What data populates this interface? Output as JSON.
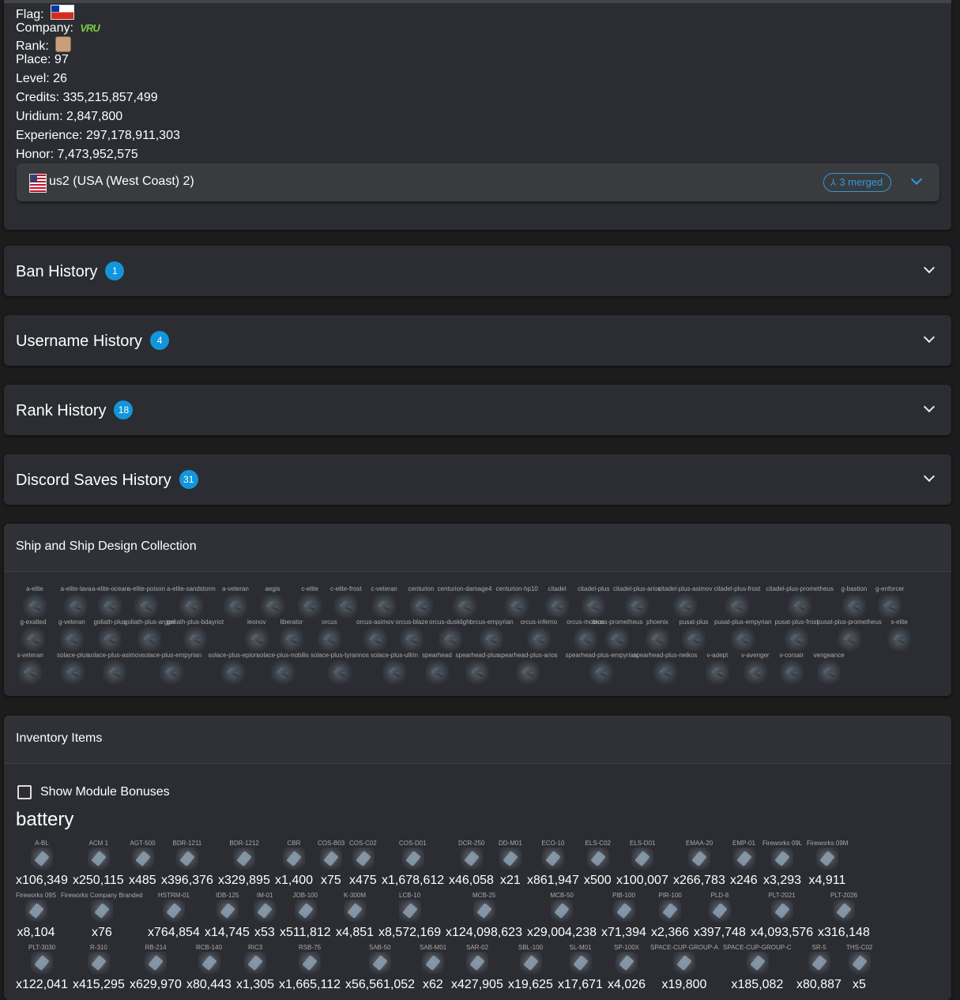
{
  "profile": {
    "flag_label": "Flag:",
    "company_label": "Company:",
    "company_logo_text": "VRU",
    "rank_label": "Rank:",
    "place": "Place: 97",
    "level": "Level: 26",
    "credits": "Credits: 335,215,857,499",
    "uridium": "Uridium: 2,847,800",
    "experience": "Experience: 297,178,911,303",
    "honor": "Honor: 7,473,952,575"
  },
  "server": {
    "name": "us2 (USA (West Coast) 2)",
    "merged_label": "3 merged"
  },
  "history_sections": [
    {
      "title": "Ban History",
      "count": "1"
    },
    {
      "title": "Username History",
      "count": "4"
    },
    {
      "title": "Rank History",
      "count": "18"
    },
    {
      "title": "Discord Saves History",
      "count": "31"
    }
  ],
  "ships": {
    "title": "Ship and Ship Design Collection",
    "row1": [
      "a-elite",
      "a-elite-lava",
      "a-elite-ocean",
      "a-elite-poison",
      "a-elite-sandstorm",
      "a-veteran",
      "aegis",
      "c-elite",
      "c-elite-frost",
      "c-veteran",
      "centurion",
      "centurion-damage4",
      "centurion-hp10",
      "citadel",
      "citadel-plus",
      "citadel-plus-arios",
      "citadel-plus-asimov",
      "citadel-plus-frost",
      "citadel-plus-prometheus",
      "g-bastion",
      "g-enforcer"
    ],
    "row2": [
      "g-exalted",
      "g-veteran",
      "goliath-plus",
      "goliath-plus-argon",
      "goliath-plus-bdayriot",
      "leonov",
      "liberator",
      "orcus",
      "orcus-asimov",
      "orcus-blaze",
      "orcus-dusklight",
      "orcus-empyrian",
      "orcus-inferno",
      "orcus-mobius",
      "orcus-prometheus",
      "phoenix",
      "pusat-plus",
      "pusat-plus-empyrian",
      "pusat-plus-frost",
      "pusat-plus-prometheus",
      "s-elite"
    ],
    "row3": [
      "s-veteran",
      "solace-plus",
      "solace-plus-asimov",
      "solace-plus-empyrian",
      "solace-plus-epion",
      "solace-plus-nobilis",
      "solace-plus-tyrannos",
      "solace-plus-ullrin",
      "spearhead",
      "spearhead-plus",
      "spearhead-plus-arios",
      "spearhead-plus-empyrian",
      "spearhead-plus-neikos",
      "v-adept",
      "v-avenger",
      "v-corsair",
      "vengeance"
    ]
  },
  "inventory": {
    "title": "Inventory Items",
    "show_bonuses_label": "Show Module Bonuses",
    "category": "battery",
    "row1": [
      {
        "name": "A-BL",
        "qty": "x106,349"
      },
      {
        "name": "ACM 1",
        "qty": "x250,115"
      },
      {
        "name": "AGT-500",
        "qty": "x485"
      },
      {
        "name": "BDR-1211",
        "qty": "x396,376"
      },
      {
        "name": "BDR-1212",
        "qty": "x329,895"
      },
      {
        "name": "CBR",
        "qty": "x1,400"
      },
      {
        "name": "COS-B03",
        "qty": "x75"
      },
      {
        "name": "COS-C02",
        "qty": "x475"
      },
      {
        "name": "COS-D01",
        "qty": "x1,678,612"
      },
      {
        "name": "DCR-250",
        "qty": "x46,058"
      },
      {
        "name": "DD-M01",
        "qty": "x21"
      },
      {
        "name": "ECO-10",
        "qty": "x861,947"
      },
      {
        "name": "ELS-C02",
        "qty": "x500"
      },
      {
        "name": "ELS-D01",
        "qty": "x100,007"
      },
      {
        "name": "EMAA-20",
        "qty": "x266,783"
      },
      {
        "name": "EMP-01",
        "qty": "x246"
      },
      {
        "name": "Fireworks 09L",
        "qty": "x3,293"
      },
      {
        "name": "Fireworks 09M",
        "qty": "x4,911"
      }
    ],
    "row2": [
      {
        "name": "Fireworks 09S",
        "qty": "x8,104"
      },
      {
        "name": "Fireworks Company Branded",
        "qty": "x76"
      },
      {
        "name": "HSTRM-01",
        "qty": "x764,854"
      },
      {
        "name": "IDB-125",
        "qty": "x14,745"
      },
      {
        "name": "IM-01",
        "qty": "x53"
      },
      {
        "name": "JOB-100",
        "qty": "x511,812"
      },
      {
        "name": "K-300M",
        "qty": "x4,851"
      },
      {
        "name": "LCB-10",
        "qty": "x8,572,169"
      },
      {
        "name": "MCB-25",
        "qty": "x124,098,623"
      },
      {
        "name": "MCB-50",
        "qty": "x29,004,238"
      },
      {
        "name": "PIB-100",
        "qty": "x71,394"
      },
      {
        "name": "PIR-100",
        "qty": "x2,366"
      },
      {
        "name": "PLD-8",
        "qty": "x397,748"
      },
      {
        "name": "PLT-2021",
        "qty": "x4,093,576"
      },
      {
        "name": "PLT-2026",
        "qty": "x316,148"
      }
    ],
    "row3": [
      {
        "name": "PLT-3030",
        "qty": "x122,041"
      },
      {
        "name": "R-310",
        "qty": "x415,295"
      },
      {
        "name": "RB-214",
        "qty": "x629,970"
      },
      {
        "name": "RCB-140",
        "qty": "x80,443"
      },
      {
        "name": "RIC3",
        "qty": "x1,305"
      },
      {
        "name": "RSB-75",
        "qty": "x1,665,112"
      },
      {
        "name": "SAB-50",
        "qty": "x56,561,052"
      },
      {
        "name": "SAB-M01",
        "qty": "x62"
      },
      {
        "name": "SAR-02",
        "qty": "x427,905"
      },
      {
        "name": "SBL-100",
        "qty": "x19,625"
      },
      {
        "name": "SL-M01",
        "qty": "x17,671"
      },
      {
        "name": "SP-100X",
        "qty": "x4,026"
      },
      {
        "name": "SPACE-CUP-GROUP-A",
        "qty": "x19,800"
      },
      {
        "name": "SPACE-CUP-GROUP-C",
        "qty": "x185,082"
      },
      {
        "name": "SR-5",
        "qty": "x80,887"
      },
      {
        "name": "THS-C02",
        "qty": "x5"
      }
    ]
  }
}
